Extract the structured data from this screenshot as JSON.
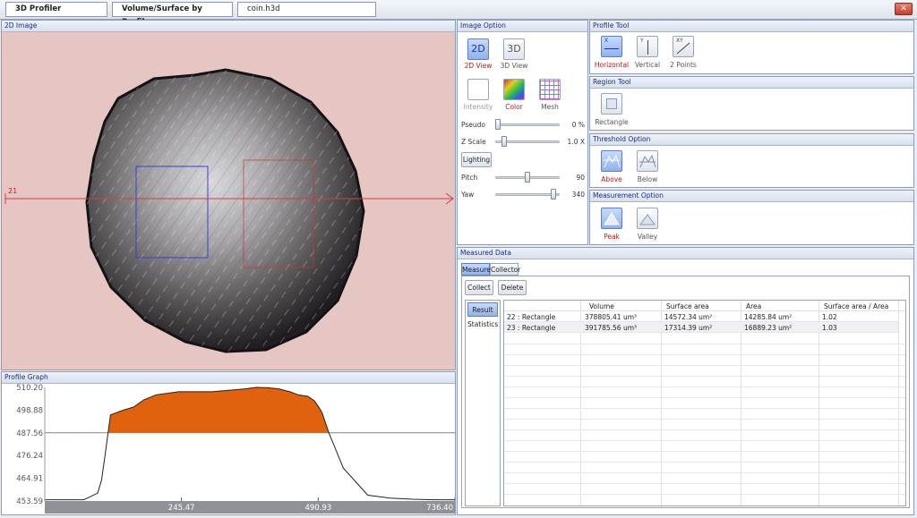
{
  "titlebar": {
    "app": "3D Profiler",
    "mode": "Volume/Surface by Profile",
    "file": "coin.h3d",
    "close_glyph": "✕"
  },
  "image2d": {
    "title": "2D Image",
    "profile_line_label": "21"
  },
  "profile_graph": {
    "title": "Profile Graph",
    "chart_data": {
      "type": "area",
      "y_ticks": [
        "510.20",
        "498.88",
        "487.56",
        "476.24",
        "464.91",
        "453.59"
      ],
      "x_ticks": [
        "245.47",
        "490.93",
        "736.40"
      ],
      "ylim": [
        453.59,
        510.2
      ],
      "xlim": [
        0,
        736.4
      ],
      "threshold": 487.56,
      "fill_color": "#e0620f",
      "threshold_color": "#5aa64a",
      "x": [
        0,
        70,
        80,
        95,
        102,
        108,
        118,
        140,
        160,
        178,
        200,
        240,
        300,
        340,
        360,
        380,
        400,
        420,
        440,
        455,
        465,
        472,
        484,
        492,
        498,
        510,
        536,
        580,
        620,
        660,
        700,
        736.4
      ],
      "y": [
        454.2,
        454.2,
        455.5,
        457.5,
        464,
        476,
        496.5,
        498.8,
        500.5,
        504,
        506.5,
        508,
        508,
        509,
        509.5,
        510.2,
        510,
        509.5,
        508,
        506.5,
        506,
        505.8,
        503.5,
        500.3,
        497.5,
        487.6,
        470,
        456.5,
        455,
        454.5,
        454.2,
        454.2
      ]
    }
  },
  "image_option": {
    "title": "Image Option",
    "view_2d": "2D",
    "view_2d_label": "2D View",
    "view_3d": "3D",
    "view_3d_label": "3D View",
    "intensity_label": "Intensity",
    "color_label": "Color",
    "mesh_label": "Mesh",
    "pseudo_label": "Pseudo",
    "pseudo_value": "0 %",
    "pseudo_level": 0,
    "zscale_label": "Z Scale",
    "zscale_value": "1.0 X",
    "zscale_level": 0.1,
    "lighting_label": "Lighting",
    "pitch_label": "Pitch",
    "pitch_value": "90",
    "pitch_level": 0.5,
    "yaw_label": "Yaw",
    "yaw_value": "340",
    "yaw_level": 0.94
  },
  "profile_tool": {
    "title": "Profile Tool",
    "horizontal_label": "Horizontal",
    "vertical_label": "Vertical",
    "two_points_label": "2 Points",
    "h_glyph": "X",
    "v_glyph": "Y",
    "xy_glyph": "XY"
  },
  "region_tool": {
    "title": "Region Tool",
    "rectangle_label": "Rectangle"
  },
  "threshold_option": {
    "title": "Threshold Option",
    "above_label": "Above",
    "below_label": "Below"
  },
  "measurement_option": {
    "title": "Measurement Option",
    "peak_label": "Peak",
    "valley_label": "Valley"
  },
  "measured_data": {
    "title": "Measured Data",
    "tab_measure": "Measure",
    "tab_collector": "Collector",
    "collect_label": "Collect",
    "delete_label": "Delete",
    "side_result": "Result",
    "side_statistics": "Statistics",
    "columns": [
      "",
      "Volume",
      "Surface area",
      "Area",
      "Surface area / Area"
    ],
    "rows": [
      [
        "22 : Rectangle",
        "378805.41 um³",
        "14572.34 um²",
        "14285.84 um²",
        "1.02"
      ],
      [
        "23 : Rectangle",
        "391785.56 um³",
        "17314.39 um²",
        "16889.23 um²",
        "1.03"
      ]
    ]
  }
}
